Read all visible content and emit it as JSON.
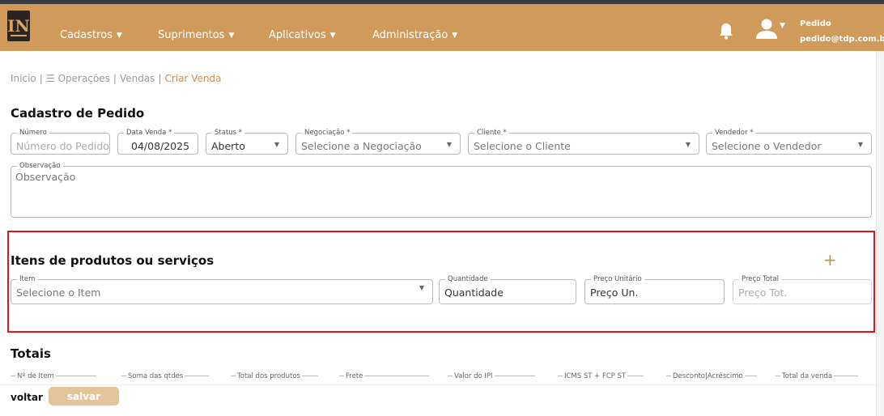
{
  "nav": {
    "logo_letters": "IN",
    "menu": [
      {
        "label": "Cadastros"
      },
      {
        "label": "Suprimentos"
      },
      {
        "label": "Aplicativos"
      },
      {
        "label": "Administração"
      }
    ],
    "user_name": "Pedido",
    "user_email": "pedido@tdp.com.br"
  },
  "breadcrumb": {
    "home": "Inicio",
    "operations": "Operações",
    "sales": "Vendas",
    "current": "Criar Venda"
  },
  "order": {
    "title": "Cadastro de Pedido",
    "numero": {
      "label": "Número",
      "placeholder": "Número do Pedido"
    },
    "data_venda": {
      "label": "Data Venda *",
      "value": "04/08/2025"
    },
    "status": {
      "label": "Status *",
      "value": "Aberto"
    },
    "negociacao": {
      "label": "Negociação *",
      "placeholder": "Selecione a Negociação"
    },
    "cliente": {
      "label": "Cliente *",
      "placeholder": "Selecione o Cliente"
    },
    "vendedor": {
      "label": "Vendedor *",
      "placeholder": "Selecione o Vendedor"
    },
    "observacao": {
      "label": "Observação",
      "placeholder": "Observação"
    }
  },
  "items": {
    "title": "Itens de produtos ou serviços",
    "item": {
      "label": "Item",
      "placeholder": "Selecione o Item"
    },
    "quantidade": {
      "label": "Quantidade",
      "placeholder": "Quantidade"
    },
    "preco_unitario": {
      "label": "Preço Unitário",
      "placeholder": "Preço Un."
    },
    "preco_total": {
      "label": "Preço Total",
      "placeholder": "Preço Tot."
    }
  },
  "totals": {
    "title": "Totais",
    "labels": [
      "Nº de Item",
      "Soma das qtdes",
      "Total dos produtos",
      "Frete",
      "Valor do IPI",
      "ICMS ST + FCP ST",
      "Desconto|Acréscimo",
      "Total da venda"
    ]
  },
  "footer": {
    "back_label": "voltar",
    "save_label": "salvar"
  },
  "colors": {
    "brand": "#cf9a5a",
    "accent_text": "#c98f4e",
    "highlight": "#e0141a"
  }
}
